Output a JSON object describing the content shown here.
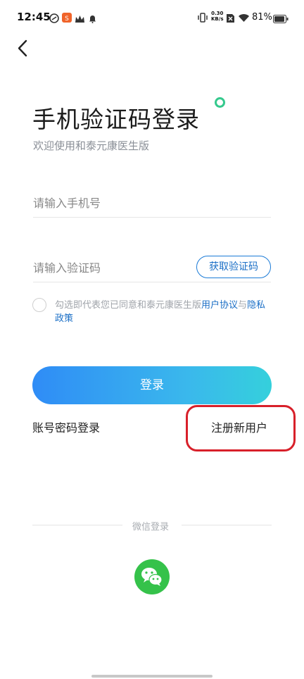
{
  "status_bar": {
    "time": "12:45",
    "net_speed_value": "0.30",
    "net_speed_unit": "KB/s",
    "battery": "81%"
  },
  "login": {
    "title": "手机验证码登录",
    "subtitle": "欢迎使用和泰元康医生版",
    "phone_placeholder": "请输入手机号",
    "code_placeholder": "请输入验证码",
    "get_code_label": "获取验证码",
    "agreement_prefix": "勾选即代表您已同意和泰元康医生版",
    "user_agreement": "用户协议",
    "and": "与",
    "privacy_policy": "隐私政策",
    "login_button": "登录",
    "password_login": "账号密码登录",
    "register_new_user": "注册新用户",
    "wechat_login_label": "微信登录"
  },
  "colors": {
    "accent_blue": "#1b6fc6",
    "gradient_start": "#2f8cf6",
    "gradient_end": "#35d0dc",
    "wechat_green": "#35c24a",
    "highlight_red": "#d8202a"
  },
  "icons": [
    "back-arrow-icon",
    "wechat-icon",
    "wifi-icon",
    "battery-icon",
    "vibrate-icon",
    "notification-bell-icon"
  ]
}
